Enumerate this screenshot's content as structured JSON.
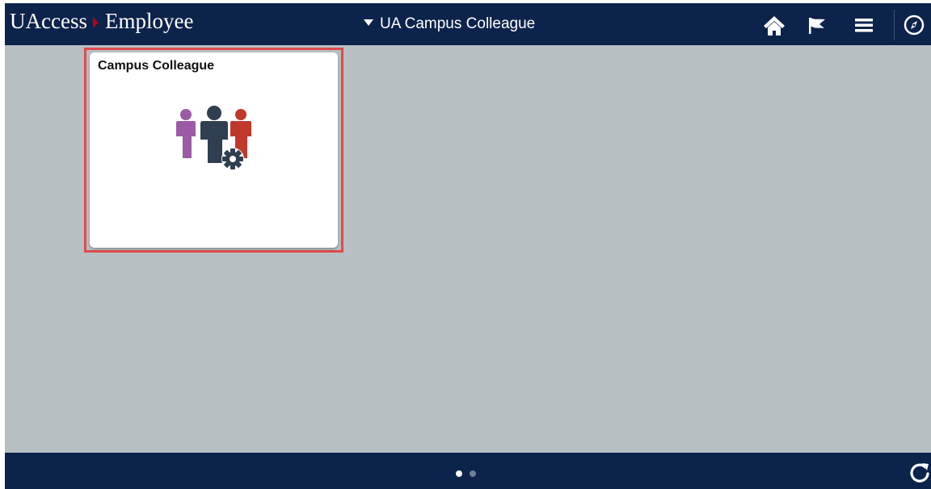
{
  "header": {
    "brand_left": "UAccess",
    "brand_right": "Employee",
    "homepage_selector": "UA Campus Colleague",
    "icons": [
      "home-icon",
      "flag-icon",
      "menu-icon",
      "navbar-compass-icon"
    ]
  },
  "content": {
    "tiles": [
      {
        "title": "Campus Colleague",
        "icon": "people-gear-icon",
        "highlighted": true
      }
    ]
  },
  "footer": {
    "page_dots": {
      "count": 2,
      "active_index": 0
    },
    "refresh_icon": "refresh-icon"
  },
  "colors": {
    "header_bg": "#0c234b",
    "content_bg": "#b7bfc3",
    "brand_separator": "#ab0520",
    "highlight_border": "#e04b4b",
    "person_purple": "#9b5ba5",
    "person_navy": "#2f3e50",
    "person_red": "#c0392b"
  }
}
